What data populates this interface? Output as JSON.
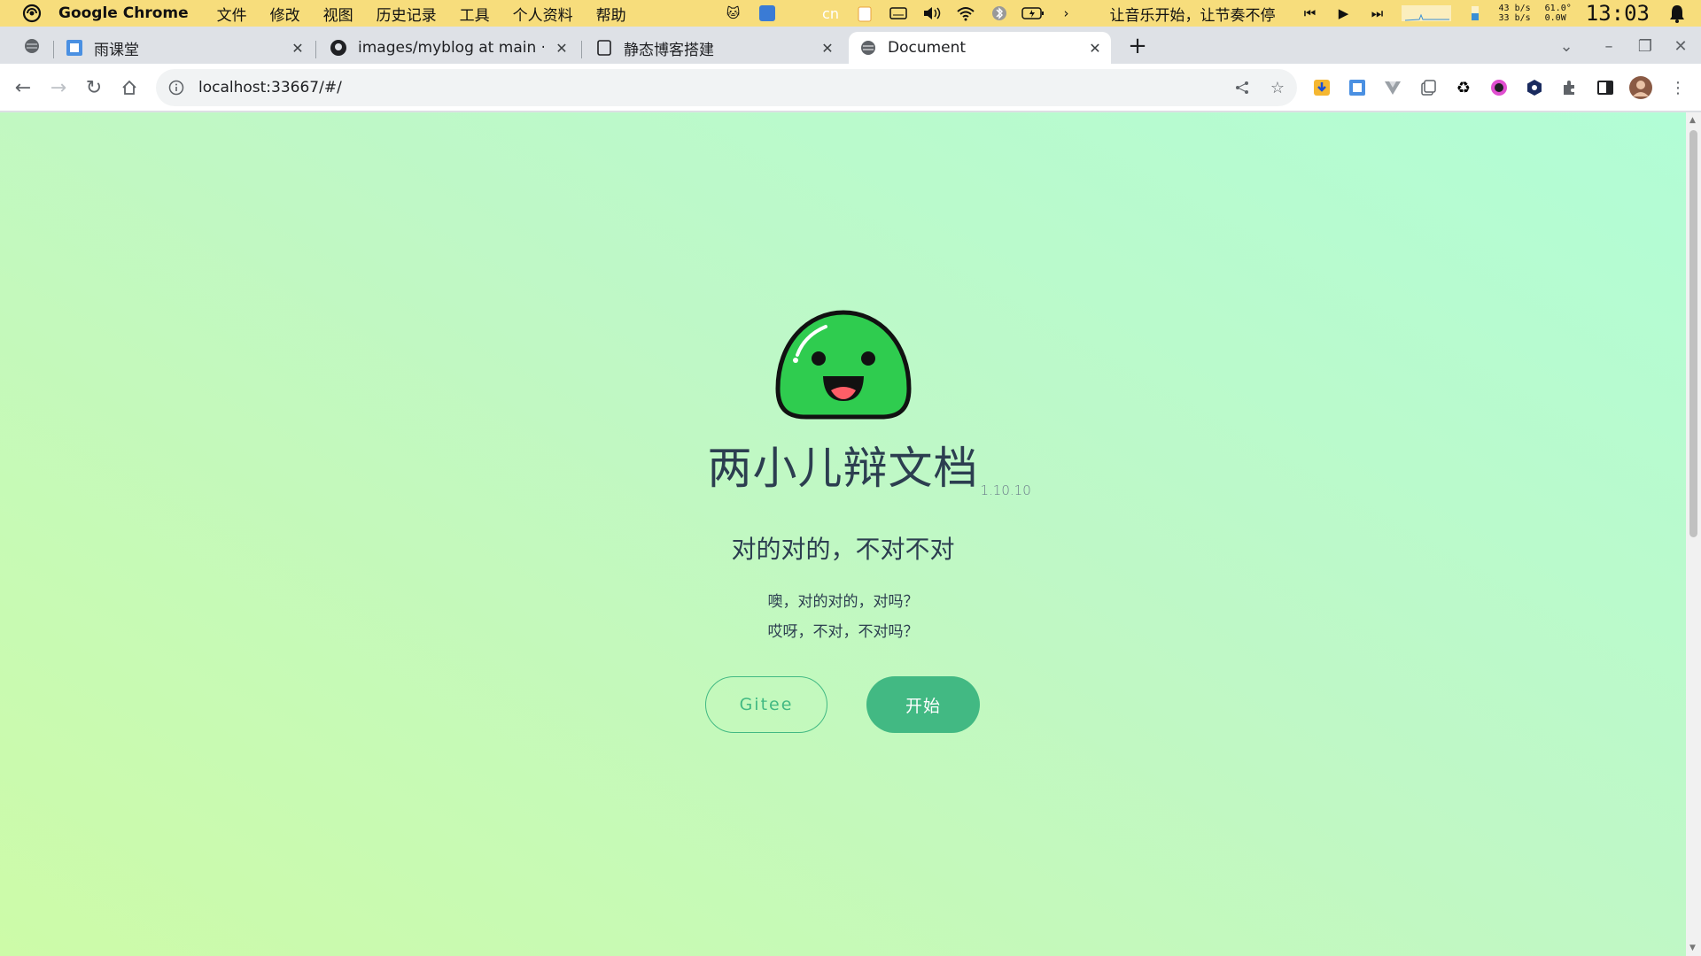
{
  "menubar": {
    "app_name": "Google Chrome",
    "items": [
      "文件",
      "修改",
      "视图",
      "历史记录",
      "工具",
      "个人资料",
      "帮助"
    ],
    "song": "让音乐开始，让节奏不停",
    "net_up": "43 b/s",
    "net_down": "33 b/s",
    "temp": "61.0°",
    "power": "0.0W",
    "clock": "13:03"
  },
  "tabs": [
    {
      "title": "雨课堂",
      "favicon": "rain-classroom-icon"
    },
    {
      "title": "images/myblog at main ·",
      "favicon": "github-icon"
    },
    {
      "title": "静态博客搭建",
      "favicon": "page-icon"
    },
    {
      "title": "Document",
      "favicon": "globe-icon",
      "active": true
    }
  ],
  "address_bar": {
    "url": "localhost:33667/#/"
  },
  "page": {
    "title": "两小儿辩文档",
    "version": "1.10.10",
    "tagline": "对的对的，不对不对",
    "desc_line1": "噢，对的对的，对吗？",
    "desc_line2": "哎呀，不对，不对吗？",
    "btn_gitee": "Gitee",
    "btn_start": "开始"
  },
  "colors": {
    "accent": "#42b983",
    "title": "#2c3e50",
    "menubar": "#f7dd7c",
    "mascot": "#2fcc4f"
  }
}
